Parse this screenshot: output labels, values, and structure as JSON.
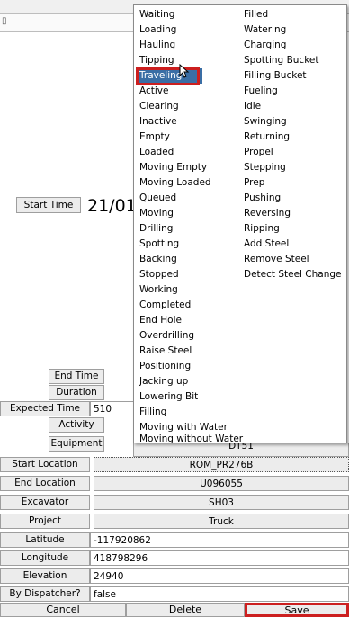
{
  "top_row_text": "▯",
  "start_time": {
    "label": "Start Time",
    "value": "21/01"
  },
  "end_time": {
    "label": "End Time"
  },
  "duration": {
    "label": "Duration"
  },
  "expected_time": {
    "label": "Expected Time",
    "value": "510"
  },
  "activity": {
    "label": "Activity"
  },
  "equipment": {
    "label": "Equipment",
    "value": "DT51"
  },
  "start_location": {
    "label": "Start Location",
    "value": "ROM_PR276B"
  },
  "end_location": {
    "label": "End Location",
    "value": "U096055"
  },
  "excavator": {
    "label": "Excavator",
    "value": "SH03"
  },
  "project": {
    "label": "Project",
    "value": "Truck"
  },
  "latitude": {
    "label": "Latitude",
    "value": "-117920862"
  },
  "longitude": {
    "label": "Longitude",
    "value": "418798296"
  },
  "elevation": {
    "label": "Elevation",
    "value": "24940"
  },
  "by_dispatcher": {
    "label": "By Dispatcher?",
    "value": "false"
  },
  "buttons": {
    "cancel": "Cancel",
    "delete": "Delete",
    "save": "Save"
  },
  "dropdown": {
    "selected": "Traveling",
    "col1": [
      "Waiting",
      "Loading",
      "Hauling",
      "Tipping",
      "Traveling",
      "Active",
      "Clearing",
      "Inactive",
      "Empty",
      "Loaded",
      "Moving Empty",
      "Moving Loaded",
      "Queued",
      "Moving",
      "Drilling",
      "Spotting",
      "Backing",
      "Stopped",
      "Working",
      "Completed",
      "End Hole",
      "Overdrilling",
      "Raise Steel",
      "Positioning",
      "Jacking up",
      "Lowering Bit",
      "Filling",
      "Moving with Water",
      "Moving without Water"
    ],
    "col2": [
      "Filled",
      "Watering",
      "Charging",
      "Spotting Bucket",
      "Filling Bucket",
      "Fueling",
      "Idle",
      "Swinging",
      "Returning",
      "Propel",
      "Stepping",
      "Prep",
      "Pushing",
      "Reversing",
      "Ripping",
      "Add Steel",
      "Remove Steel",
      "Detect Steel Change"
    ]
  },
  "colors": {
    "highlight": "#3a6ea5",
    "annotation_red": "#cc1f1f"
  }
}
